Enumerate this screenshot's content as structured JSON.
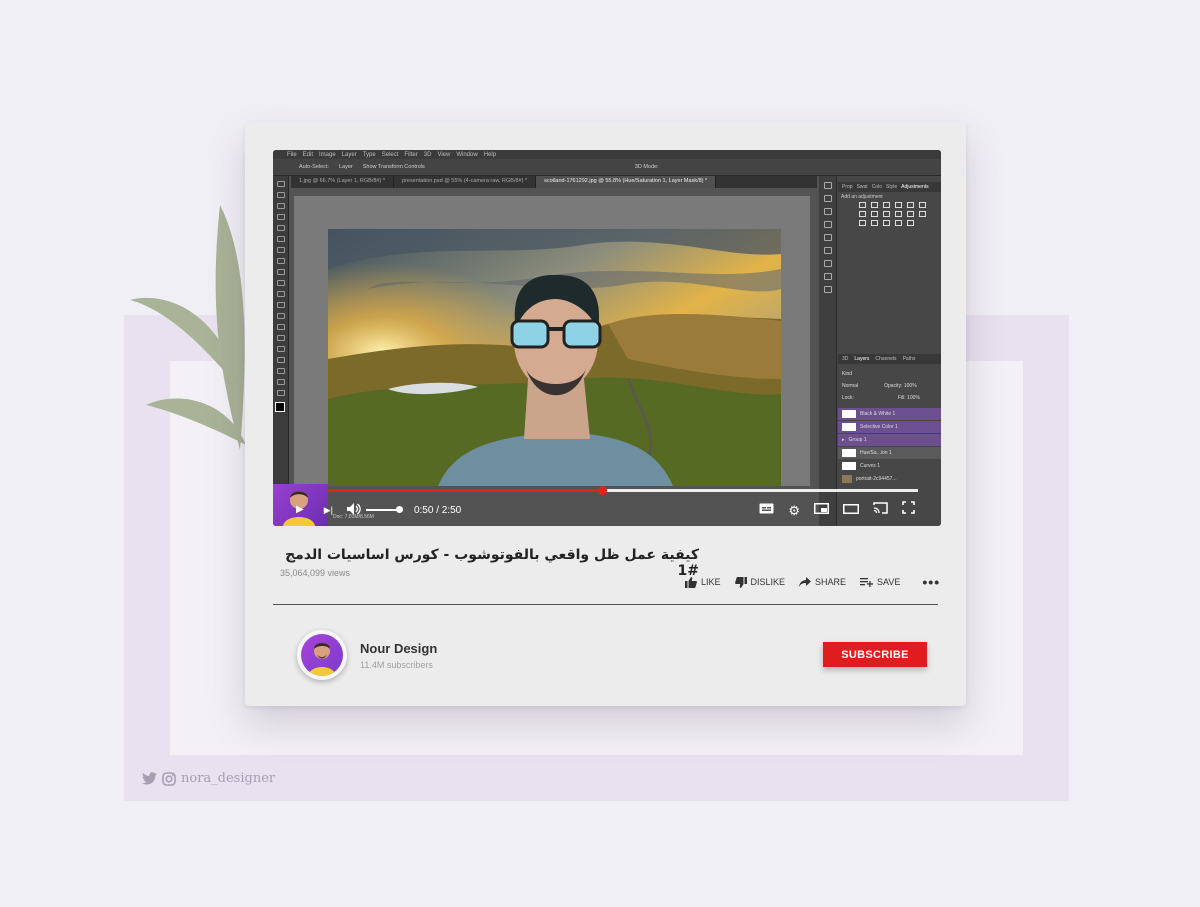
{
  "video": {
    "title": "كيفية عمل ظل واقعي بالفوتوشوب - كورس اساسيات الدمج #1",
    "views": "35,064,099 views",
    "time": "0:50 / 2:50",
    "progress": 0.466,
    "volume": 1.0
  },
  "photoshop": {
    "menus": [
      "File",
      "Edit",
      "Image",
      "Layer",
      "Type",
      "Select",
      "Filter",
      "3D",
      "View",
      "Window",
      "Help"
    ],
    "options": {
      "auto_select": "Auto-Select:",
      "layer": "Layer",
      "transform": "Show Transform Controls",
      "mode": "3D Mode:"
    },
    "tabs": [
      "1.jpg @ 66.7% (Layer 1, RGB/8#) *",
      "presentation.psd @ 55% (4-camera raw, RGB/8#) *",
      "scotland-1761292.jpg @ 55.8% (Hue/Saturation 1, Layer Mask/8) *"
    ],
    "panel_tabs": [
      "Prop",
      "Swat",
      "Colo",
      "Style",
      "Adjustments"
    ],
    "adjust_title": "Add an adjustment",
    "layer_tabs": [
      "3D",
      "Layers",
      "Channels",
      "Paths"
    ],
    "layer_kind": "Kind",
    "blend": "Normal",
    "opacity": "Opacity: 100%",
    "fill": "Fill: 100%",
    "lock": "Lock:",
    "layers": [
      "Black & White 1",
      "Selective Color 1",
      "Group 1",
      "Hue/Sa...ion 1",
      "Curves 1",
      "portrait-2c94457..."
    ],
    "doc": "Doc: 7.81M/8.56M"
  },
  "actions": {
    "like": "LIKE",
    "dislike": "DISLIKE",
    "share": "SHARE",
    "save": "SAVE",
    "more": "•••"
  },
  "channel": {
    "name": "Nour Design",
    "subscribers": "11.4M subscribers",
    "subscribe_label": "SUBSCRIBE"
  },
  "watermark": {
    "handle": "nora_designer"
  },
  "colors": {
    "accent_red": "#e01c1c",
    "progress_red": "#e62117",
    "purple": "#8a3fd0",
    "leaf_green": "#a8b397"
  }
}
